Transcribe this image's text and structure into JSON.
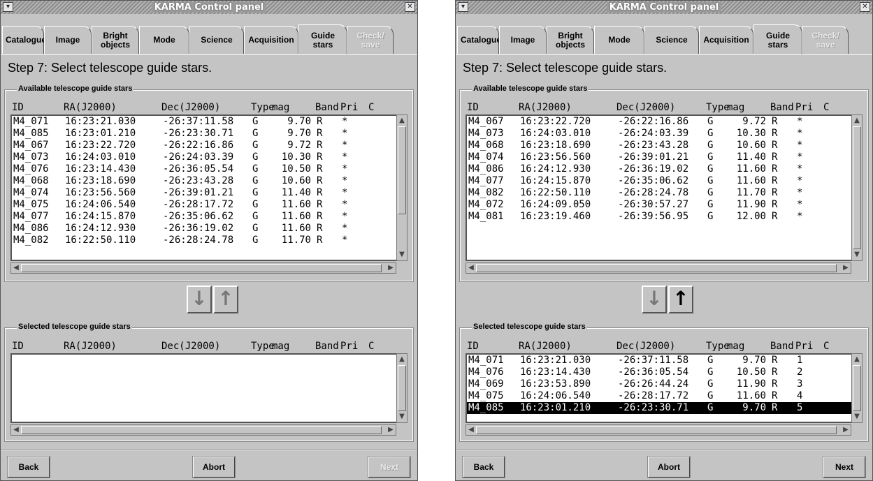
{
  "window_title": "KARMA Control panel",
  "tabs": [
    {
      "label": "Catalogue",
      "active": false,
      "disabled": false
    },
    {
      "label": "Image",
      "active": false,
      "disabled": false
    },
    {
      "label": "Bright objects",
      "active": false,
      "disabled": false
    },
    {
      "label": "Mode",
      "active": false,
      "disabled": false
    },
    {
      "label": "Science",
      "active": false,
      "disabled": false
    },
    {
      "label": "Acquisition",
      "active": false,
      "disabled": false
    },
    {
      "label": "Guide stars",
      "active": true,
      "disabled": false
    },
    {
      "label": "Check/ save",
      "active": false,
      "disabled": true
    }
  ],
  "step_text": "Step 7: Select telescope guide stars.",
  "available_label": "Available telescope guide stars",
  "selected_label": "Selected telescope guide stars",
  "columns": [
    "ID",
    "RA(J2000)",
    "Dec(J2000)",
    "Type",
    "mag",
    "Band",
    "Pri",
    "C"
  ],
  "buttons": {
    "back": "Back",
    "abort": "Abort",
    "next": "Next"
  },
  "panels": [
    {
      "available_rows": [
        [
          "M4_071",
          "16:23:21.030",
          "-26:37:11.58",
          "G",
          "9.70",
          "R",
          "*"
        ],
        [
          "M4_085",
          "16:23:01.210",
          "-26:23:30.71",
          "G",
          "9.70",
          "R",
          "*"
        ],
        [
          "M4_067",
          "16:23:22.720",
          "-26:22:16.86",
          "G",
          "9.72",
          "R",
          "*"
        ],
        [
          "M4_073",
          "16:24:03.010",
          "-26:24:03.39",
          "G",
          "10.30",
          "R",
          "*"
        ],
        [
          "M4_076",
          "16:23:14.430",
          "-26:36:05.54",
          "G",
          "10.50",
          "R",
          "*"
        ],
        [
          "M4_068",
          "16:23:18.690",
          "-26:23:43.28",
          "G",
          "10.60",
          "R",
          "*"
        ],
        [
          "M4_074",
          "16:23:56.560",
          "-26:39:01.21",
          "G",
          "11.40",
          "R",
          "*"
        ],
        [
          "M4_075",
          "16:24:06.540",
          "-26:28:17.72",
          "G",
          "11.60",
          "R",
          "*"
        ],
        [
          "M4_077",
          "16:24:15.870",
          "-26:35:06.62",
          "G",
          "11.60",
          "R",
          "*"
        ],
        [
          "M4_086",
          "16:24:12.930",
          "-26:36:19.02",
          "G",
          "11.60",
          "R",
          "*"
        ],
        [
          "M4_082",
          "16:22:50.110",
          "-26:28:24.78",
          "G",
          "11.70",
          "R",
          "*"
        ]
      ],
      "selected_rows": [],
      "highlighted_selected_index": -1,
      "up_enabled": false,
      "next_enabled": false
    },
    {
      "available_rows": [
        [
          "M4_067",
          "16:23:22.720",
          "-26:22:16.86",
          "G",
          "9.72",
          "R",
          "*"
        ],
        [
          "M4_073",
          "16:24:03.010",
          "-26:24:03.39",
          "G",
          "10.30",
          "R",
          "*"
        ],
        [
          "M4_068",
          "16:23:18.690",
          "-26:23:43.28",
          "G",
          "10.60",
          "R",
          "*"
        ],
        [
          "M4_074",
          "16:23:56.560",
          "-26:39:01.21",
          "G",
          "11.40",
          "R",
          "*"
        ],
        [
          "M4_086",
          "16:24:12.930",
          "-26:36:19.02",
          "G",
          "11.60",
          "R",
          "*"
        ],
        [
          "M4_077",
          "16:24:15.870",
          "-26:35:06.62",
          "G",
          "11.60",
          "R",
          "*"
        ],
        [
          "M4_082",
          "16:22:50.110",
          "-26:28:24.78",
          "G",
          "11.70",
          "R",
          "*"
        ],
        [
          "M4_072",
          "16:24:09.050",
          "-26:30:57.27",
          "G",
          "11.90",
          "R",
          "*"
        ],
        [
          "M4_081",
          "16:23:19.460",
          "-26:39:56.95",
          "G",
          "12.00",
          "R",
          "*"
        ]
      ],
      "selected_rows": [
        [
          "M4_071",
          "16:23:21.030",
          "-26:37:11.58",
          "G",
          "9.70",
          "R",
          "1"
        ],
        [
          "M4_076",
          "16:23:14.430",
          "-26:36:05.54",
          "G",
          "10.50",
          "R",
          "2"
        ],
        [
          "M4_069",
          "16:23:53.890",
          "-26:26:44.24",
          "G",
          "11.90",
          "R",
          "3"
        ],
        [
          "M4_075",
          "16:24:06.540",
          "-26:28:17.72",
          "G",
          "11.60",
          "R",
          "4"
        ],
        [
          "M4_085",
          "16:23:01.210",
          "-26:23:30.71",
          "G",
          "9.70",
          "R",
          "5"
        ]
      ],
      "highlighted_selected_index": 4,
      "up_enabled": true,
      "next_enabled": true
    }
  ]
}
